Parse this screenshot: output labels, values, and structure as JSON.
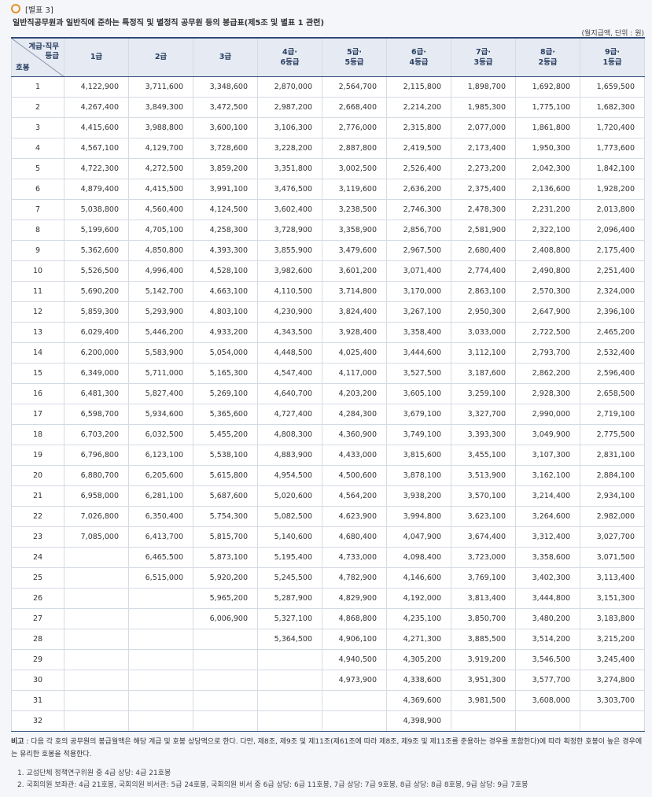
{
  "header": {
    "label": "[별표 3]",
    "subtitle": "일반직공무원과 일반직에 준하는 특정직 및 별정직 공무원 등의 봉급표(제5조 및 별표 1 관련)",
    "unit": "(월지급액, 단위 : 원)"
  },
  "table": {
    "corner_top": "계급·직무\n등급",
    "corner_bottom": "호봉",
    "columns": [
      "1급",
      "2급",
      "3급",
      "4급·\n6등급",
      "5급·\n5등급",
      "6급·\n4등급",
      "7급·\n3등급",
      "8급·\n2등급",
      "9급·\n1등급"
    ],
    "rows": [
      [
        "1",
        "4,122,900",
        "3,711,600",
        "3,348,600",
        "2,870,000",
        "2,564,700",
        "2,115,800",
        "1,898,700",
        "1,692,800",
        "1,659,500"
      ],
      [
        "2",
        "4,267,400",
        "3,849,300",
        "3,472,500",
        "2,987,200",
        "2,668,400",
        "2,214,200",
        "1,985,300",
        "1,775,100",
        "1,682,300"
      ],
      [
        "3",
        "4,415,600",
        "3,988,800",
        "3,600,100",
        "3,106,300",
        "2,776,000",
        "2,315,800",
        "2,077,000",
        "1,861,800",
        "1,720,400"
      ],
      [
        "4",
        "4,567,100",
        "4,129,700",
        "3,728,600",
        "3,228,200",
        "2,887,800",
        "2,419,500",
        "2,173,400",
        "1,950,300",
        "1,773,600"
      ],
      [
        "5",
        "4,722,300",
        "4,272,500",
        "3,859,200",
        "3,351,800",
        "3,002,500",
        "2,526,400",
        "2,273,200",
        "2,042,300",
        "1,842,100"
      ],
      [
        "6",
        "4,879,400",
        "4,415,500",
        "3,991,100",
        "3,476,500",
        "3,119,600",
        "2,636,200",
        "2,375,400",
        "2,136,600",
        "1,928,200"
      ],
      [
        "7",
        "5,038,800",
        "4,560,400",
        "4,124,500",
        "3,602,400",
        "3,238,500",
        "2,746,300",
        "2,478,300",
        "2,231,200",
        "2,013,800"
      ],
      [
        "8",
        "5,199,600",
        "4,705,100",
        "4,258,300",
        "3,728,900",
        "3,358,900",
        "2,856,700",
        "2,581,900",
        "2,322,100",
        "2,096,400"
      ],
      [
        "9",
        "5,362,600",
        "4,850,800",
        "4,393,300",
        "3,855,900",
        "3,479,600",
        "2,967,500",
        "2,680,400",
        "2,408,800",
        "2,175,400"
      ],
      [
        "10",
        "5,526,500",
        "4,996,400",
        "4,528,100",
        "3,982,600",
        "3,601,200",
        "3,071,400",
        "2,774,400",
        "2,490,800",
        "2,251,400"
      ],
      [
        "11",
        "5,690,200",
        "5,142,700",
        "4,663,100",
        "4,110,500",
        "3,714,800",
        "3,170,000",
        "2,863,100",
        "2,570,300",
        "2,324,000"
      ],
      [
        "12",
        "5,859,300",
        "5,293,900",
        "4,803,100",
        "4,230,900",
        "3,824,400",
        "3,267,100",
        "2,950,300",
        "2,647,900",
        "2,396,100"
      ],
      [
        "13",
        "6,029,400",
        "5,446,200",
        "4,933,200",
        "4,343,500",
        "3,928,400",
        "3,358,400",
        "3,033,000",
        "2,722,500",
        "2,465,200"
      ],
      [
        "14",
        "6,200,000",
        "5,583,900",
        "5,054,000",
        "4,448,500",
        "4,025,400",
        "3,444,600",
        "3,112,100",
        "2,793,700",
        "2,532,400"
      ],
      [
        "15",
        "6,349,000",
        "5,711,000",
        "5,165,300",
        "4,547,400",
        "4,117,000",
        "3,527,500",
        "3,187,600",
        "2,862,200",
        "2,596,400"
      ],
      [
        "16",
        "6,481,300",
        "5,827,400",
        "5,269,100",
        "4,640,700",
        "4,203,200",
        "3,605,100",
        "3,259,100",
        "2,928,300",
        "2,658,500"
      ],
      [
        "17",
        "6,598,700",
        "5,934,600",
        "5,365,600",
        "4,727,400",
        "4,284,300",
        "3,679,100",
        "3,327,700",
        "2,990,000",
        "2,719,100"
      ],
      [
        "18",
        "6,703,200",
        "6,032,500",
        "5,455,200",
        "4,808,300",
        "4,360,900",
        "3,749,100",
        "3,393,300",
        "3,049,900",
        "2,775,500"
      ],
      [
        "19",
        "6,796,800",
        "6,123,100",
        "5,538,100",
        "4,883,900",
        "4,433,000",
        "3,815,600",
        "3,455,100",
        "3,107,300",
        "2,831,100"
      ],
      [
        "20",
        "6,880,700",
        "6,205,600",
        "5,615,800",
        "4,954,500",
        "4,500,600",
        "3,878,100",
        "3,513,900",
        "3,162,100",
        "2,884,100"
      ],
      [
        "21",
        "6,958,000",
        "6,281,100",
        "5,687,600",
        "5,020,600",
        "4,564,200",
        "3,938,200",
        "3,570,100",
        "3,214,400",
        "2,934,100"
      ],
      [
        "22",
        "7,026,800",
        "6,350,400",
        "5,754,300",
        "5,082,500",
        "4,623,900",
        "3,994,800",
        "3,623,100",
        "3,264,600",
        "2,982,000"
      ],
      [
        "23",
        "7,085,000",
        "6,413,700",
        "5,815,700",
        "5,140,600",
        "4,680,400",
        "4,047,900",
        "3,674,400",
        "3,312,400",
        "3,027,700"
      ],
      [
        "24",
        "",
        "6,465,500",
        "5,873,100",
        "5,195,400",
        "4,733,000",
        "4,098,400",
        "3,723,000",
        "3,358,600",
        "3,071,500"
      ],
      [
        "25",
        "",
        "6,515,000",
        "5,920,200",
        "5,245,500",
        "4,782,900",
        "4,146,600",
        "3,769,100",
        "3,402,300",
        "3,113,400"
      ],
      [
        "26",
        "",
        "",
        "5,965,200",
        "5,287,900",
        "4,829,900",
        "4,192,000",
        "3,813,400",
        "3,444,800",
        "3,151,300"
      ],
      [
        "27",
        "",
        "",
        "6,006,900",
        "5,327,100",
        "4,868,800",
        "4,235,100",
        "3,850,700",
        "3,480,200",
        "3,183,800"
      ],
      [
        "28",
        "",
        "",
        "",
        "5,364,500",
        "4,906,100",
        "4,271,300",
        "3,885,500",
        "3,514,200",
        "3,215,200"
      ],
      [
        "29",
        "",
        "",
        "",
        "",
        "4,940,500",
        "4,305,200",
        "3,919,200",
        "3,546,500",
        "3,245,400"
      ],
      [
        "30",
        "",
        "",
        "",
        "",
        "4,973,900",
        "4,338,600",
        "3,951,300",
        "3,577,700",
        "3,274,800"
      ],
      [
        "31",
        "",
        "",
        "",
        "",
        "",
        "4,369,600",
        "3,981,500",
        "3,608,000",
        "3,303,700"
      ],
      [
        "32",
        "",
        "",
        "",
        "",
        "",
        "4,398,900",
        "",
        "",
        ""
      ]
    ]
  },
  "note": {
    "label": "비고",
    "text": " : 다음 각 호의 공무원의 봉급월액은 해당 계급 및 호봉 상당액으로 한다. 다만, 제8조, 제9조 및 제11조(제61조에 따라 제8조, 제9조 및 제11조를 준용하는 경우를 포함한다)에 따라 획정한 호봉이 높은 경우에는 유리한 호봉을 적용한다."
  },
  "footnotes": [
    "1.  교섭단체 정책연구위원 중 4급 상당: 4급 21호봉",
    "2.  국회의원 보좌관: 4급 21호봉, 국회의원 비서관: 5급 24호봉, 국회의원 비서 중 6급 상당: 6급 11호봉, 7급 상당: 7급 9호봉, 8급 상당: 8급 8호봉, 9급 상당: 9급 7호봉"
  ]
}
